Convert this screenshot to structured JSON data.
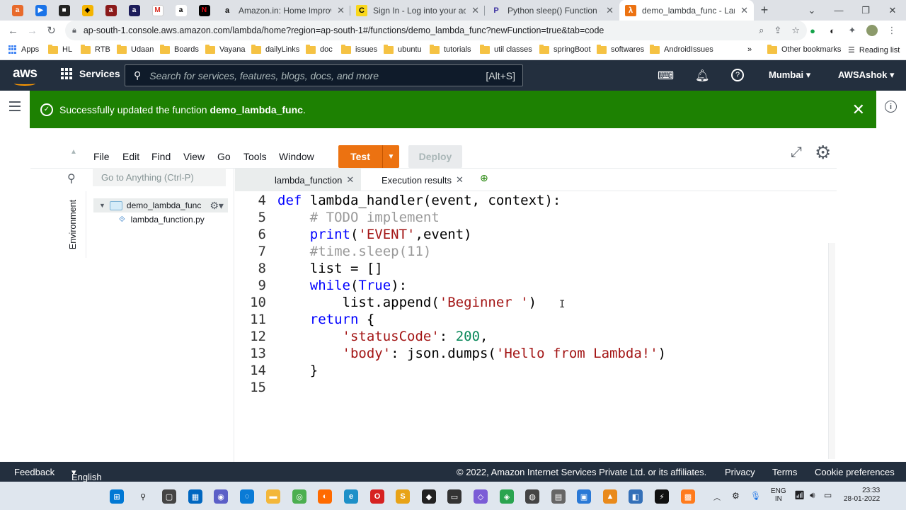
{
  "browser": {
    "tabs": [
      {
        "title": "Amazon.in: Home Improvemen",
        "active": false
      },
      {
        "title": "Sign In - Log into your accoun",
        "active": false
      },
      {
        "title": "Python sleep() Function (With",
        "active": false
      },
      {
        "title": "demo_lambda_func - Lambda",
        "active": true
      }
    ],
    "url": "ap-south-1.console.aws.amazon.com/lambda/home?region=ap-south-1#/functions/demo_lambda_func?newFunction=true&tab=code",
    "bookmarks": [
      "Apps",
      "HL",
      "RTB",
      "Udaan",
      "Boards",
      "Vayana",
      "dailyLinks",
      "doc",
      "issues",
      "ubuntu",
      "tutorials",
      "util classes",
      "springBoot",
      "softwares",
      "AndroidIssues"
    ],
    "other_bookmarks": "Other bookmarks",
    "reading_list": "Reading list",
    "more": "»"
  },
  "aws": {
    "logo": "aws",
    "services": "Services",
    "search_placeholder": "Search for services, features, blogs, docs, and more",
    "search_shortcut": "[Alt+S]",
    "region": "Mumbai",
    "account": "AWSAshok"
  },
  "notice": {
    "prefix": "Successfully updated the function ",
    "function": "demo_lambda_func",
    "suffix": "."
  },
  "ide": {
    "menu": [
      "File",
      "Edit",
      "Find",
      "View",
      "Go",
      "Tools",
      "Window"
    ],
    "test": "Test",
    "deploy": "Deploy",
    "goto_placeholder": "Go to Anything (Ctrl-P)",
    "environment": "Environment",
    "folder": "demo_lambda_func",
    "file": "lambda_function.py",
    "tabs": [
      "lambda_function",
      "Execution results"
    ],
    "lines": [
      {
        "n": "4",
        "code": "def lambda_handler(event, context):"
      },
      {
        "n": "5",
        "code": "    # TODO implement"
      },
      {
        "n": "6",
        "code": "    print('EVENT',event)"
      },
      {
        "n": "7",
        "code": "    #time.sleep(11)"
      },
      {
        "n": "8",
        "code": "    list = []"
      },
      {
        "n": "9",
        "code": "    while(True):"
      },
      {
        "n": "10",
        "code": "        list.append('Beginner ')"
      },
      {
        "n": "11",
        "code": "    return {"
      },
      {
        "n": "12",
        "code": "        'statusCode': 200,"
      },
      {
        "n": "13",
        "code": "        'body': json.dumps('Hello from Lambda!')"
      },
      {
        "n": "14",
        "code": "    }"
      },
      {
        "n": "15",
        "code": ""
      }
    ]
  },
  "footer": {
    "feedback": "Feedback",
    "language": "English (US)",
    "copyright": "© 2022, Amazon Internet Services Private Ltd. or its affiliates.",
    "privacy": "Privacy",
    "terms": "Terms",
    "cookies": "Cookie preferences"
  },
  "taskbar": {
    "lang": "ENG",
    "region": "IN",
    "time": "23:33",
    "date": "28-01-2022"
  },
  "colors": {
    "aws_header": "#232f3e",
    "success": "#1d8102",
    "test_button": "#ec7211"
  }
}
